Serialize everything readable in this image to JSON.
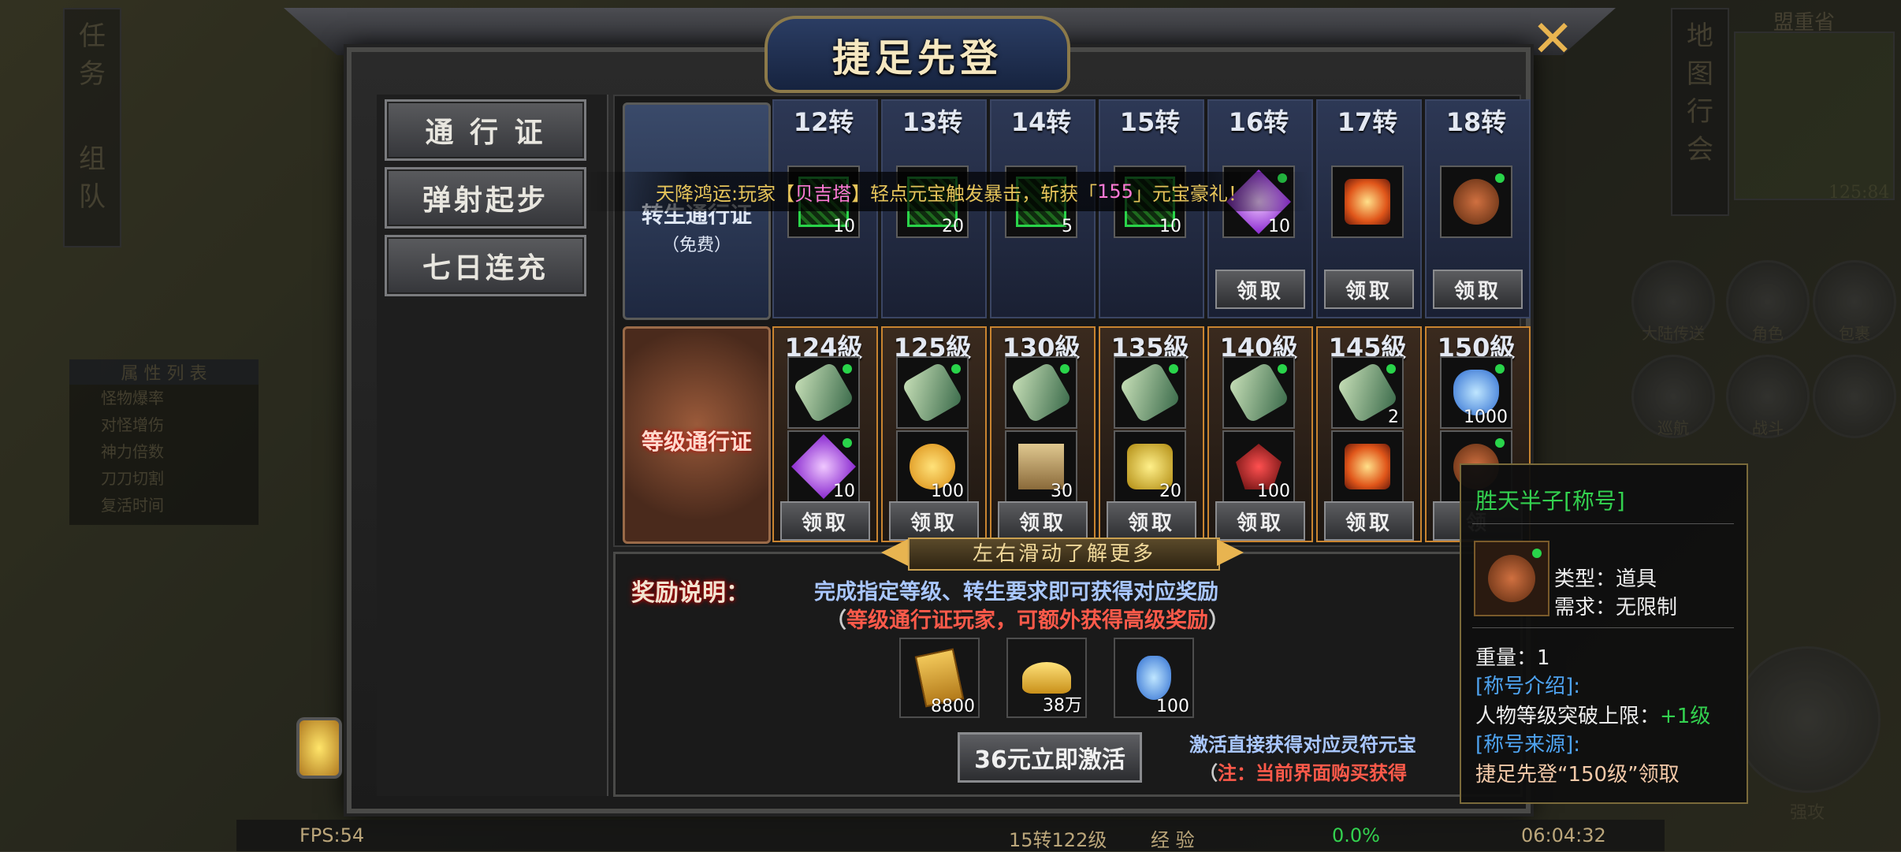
{
  "background": {
    "left_menu": [
      "任",
      "务",
      "组",
      "队"
    ],
    "right_menu": [
      "地",
      "图",
      "行",
      "会"
    ],
    "region_label": "盟重省",
    "coords": "125:84",
    "side_buttons": [
      "大陆传送",
      "角色",
      "包裹",
      "巡航",
      "战斗",
      "强攻"
    ],
    "attr_list_title": "属 性 列 表",
    "attr_items": [
      "怪物爆率",
      "对怪增伤",
      "神力倍数",
      "刀刀切割",
      "复活时间"
    ]
  },
  "window": {
    "title": "捷足先登",
    "close_label": "✕"
  },
  "nav": {
    "items": [
      {
        "label": "通 行 证"
      },
      {
        "label": "弹射起步"
      },
      {
        "label": "七日连充"
      }
    ]
  },
  "rebirth_pass": {
    "label": "转生通行证",
    "sub": "（免费）",
    "columns": [
      {
        "header": "12转",
        "qty": "10",
        "icon": "green-stamp-icon",
        "claim": ""
      },
      {
        "header": "13转",
        "qty": "20",
        "icon": "green-stamp-icon",
        "claim": ""
      },
      {
        "header": "14转",
        "qty": "5",
        "icon": "green-stamp-icon",
        "claim": ""
      },
      {
        "header": "15转",
        "qty": "10",
        "icon": "green-stamp-icon",
        "claim": ""
      },
      {
        "header": "16转",
        "qty": "10",
        "icon": "purple-crystal-icon",
        "claim": "领取"
      },
      {
        "header": "17转",
        "qty": "",
        "icon": "fire-scroll-icon",
        "claim": "领取"
      },
      {
        "header": "18转",
        "qty": "",
        "icon": "dragon-title-icon",
        "claim": "领取"
      }
    ]
  },
  "level_pass": {
    "label": "等级通行证",
    "columns": [
      {
        "header": "124級",
        "top_icon": "scroll-icon",
        "top_qty": "",
        "bottom_icon": "purple-crystal-icon",
        "bottom_qty": "10",
        "claim": "领取"
      },
      {
        "header": "125級",
        "top_icon": "scroll-icon",
        "top_qty": "",
        "bottom_icon": "gold-coin-icon",
        "bottom_qty": "100",
        "claim": "领取"
      },
      {
        "header": "130級",
        "top_icon": "scroll-icon",
        "top_qty": "",
        "bottom_icon": "skill-book-icon",
        "bottom_qty": "30",
        "claim": "领取"
      },
      {
        "header": "135級",
        "top_icon": "scroll-icon",
        "top_qty": "",
        "bottom_icon": "gold-armor-icon",
        "bottom_qty": "20",
        "claim": "领取"
      },
      {
        "header": "140級",
        "top_icon": "scroll-icon",
        "top_qty": "",
        "bottom_icon": "red-wings-icon",
        "bottom_qty": "100",
        "claim": "领取"
      },
      {
        "header": "145級",
        "top_icon": "scroll-icon",
        "top_qty": "2",
        "bottom_icon": "fire-scroll-icon",
        "bottom_qty": "",
        "claim": "领取"
      },
      {
        "header": "150級",
        "top_icon": "blue-crystal-icon",
        "top_qty": "1000",
        "bottom_icon": "dragon-title-icon",
        "bottom_qty": "",
        "claim": "领"
      }
    ]
  },
  "marquee": {
    "prefix": "天降鸿运:玩家【",
    "player": "贝吉塔",
    "middle": "】轻点元宝触发暴击，斩获「",
    "amount": "155",
    "suffix": "」元宝豪礼！"
  },
  "scroll_hint": "左右滑动了解更多",
  "reward": {
    "title": "奖励说明：",
    "line1": "完成指定等级、转生要求即可获得对应奖励",
    "line2_open": "（",
    "line2": "等级通行证玩家，可额外获得高级奖励",
    "line2_close": "）",
    "items": [
      {
        "icon": "gold-cards-icon",
        "qty": "8800"
      },
      {
        "icon": "gold-ingot-icon",
        "qty": "38万"
      },
      {
        "icon": "blue-crystal-icon",
        "qty": "100"
      }
    ],
    "activate_label": "36元立即激活",
    "note1": "激活直接获得对应灵符元宝",
    "note2_open": "（",
    "note2_label": "注：",
    "note2": "当前界面购买获得"
  },
  "tooltip": {
    "name": "胜天半子[称号]",
    "type": "类型：道具",
    "require": "需求：无限制",
    "weight": "重量：1",
    "intro_header": "[称号介绍]:",
    "intro_text": "人物等级突破上限：",
    "intro_value": "+1级",
    "source_header": "[称号来源]:",
    "source_text": "捷足先登“150级”领取"
  },
  "status_bar": {
    "fps": "FPS:54",
    "level": "15转122级",
    "exp_label": "经 验",
    "exp": "0.0%",
    "time": "06:04:32"
  },
  "colors": {
    "gold": "#e8b450",
    "tooltip_green": "#33d14f",
    "tooltip_blue": "#4ea3f0",
    "reward_blue": "#a9c7ff",
    "reward_red": "#ff5a4a"
  }
}
